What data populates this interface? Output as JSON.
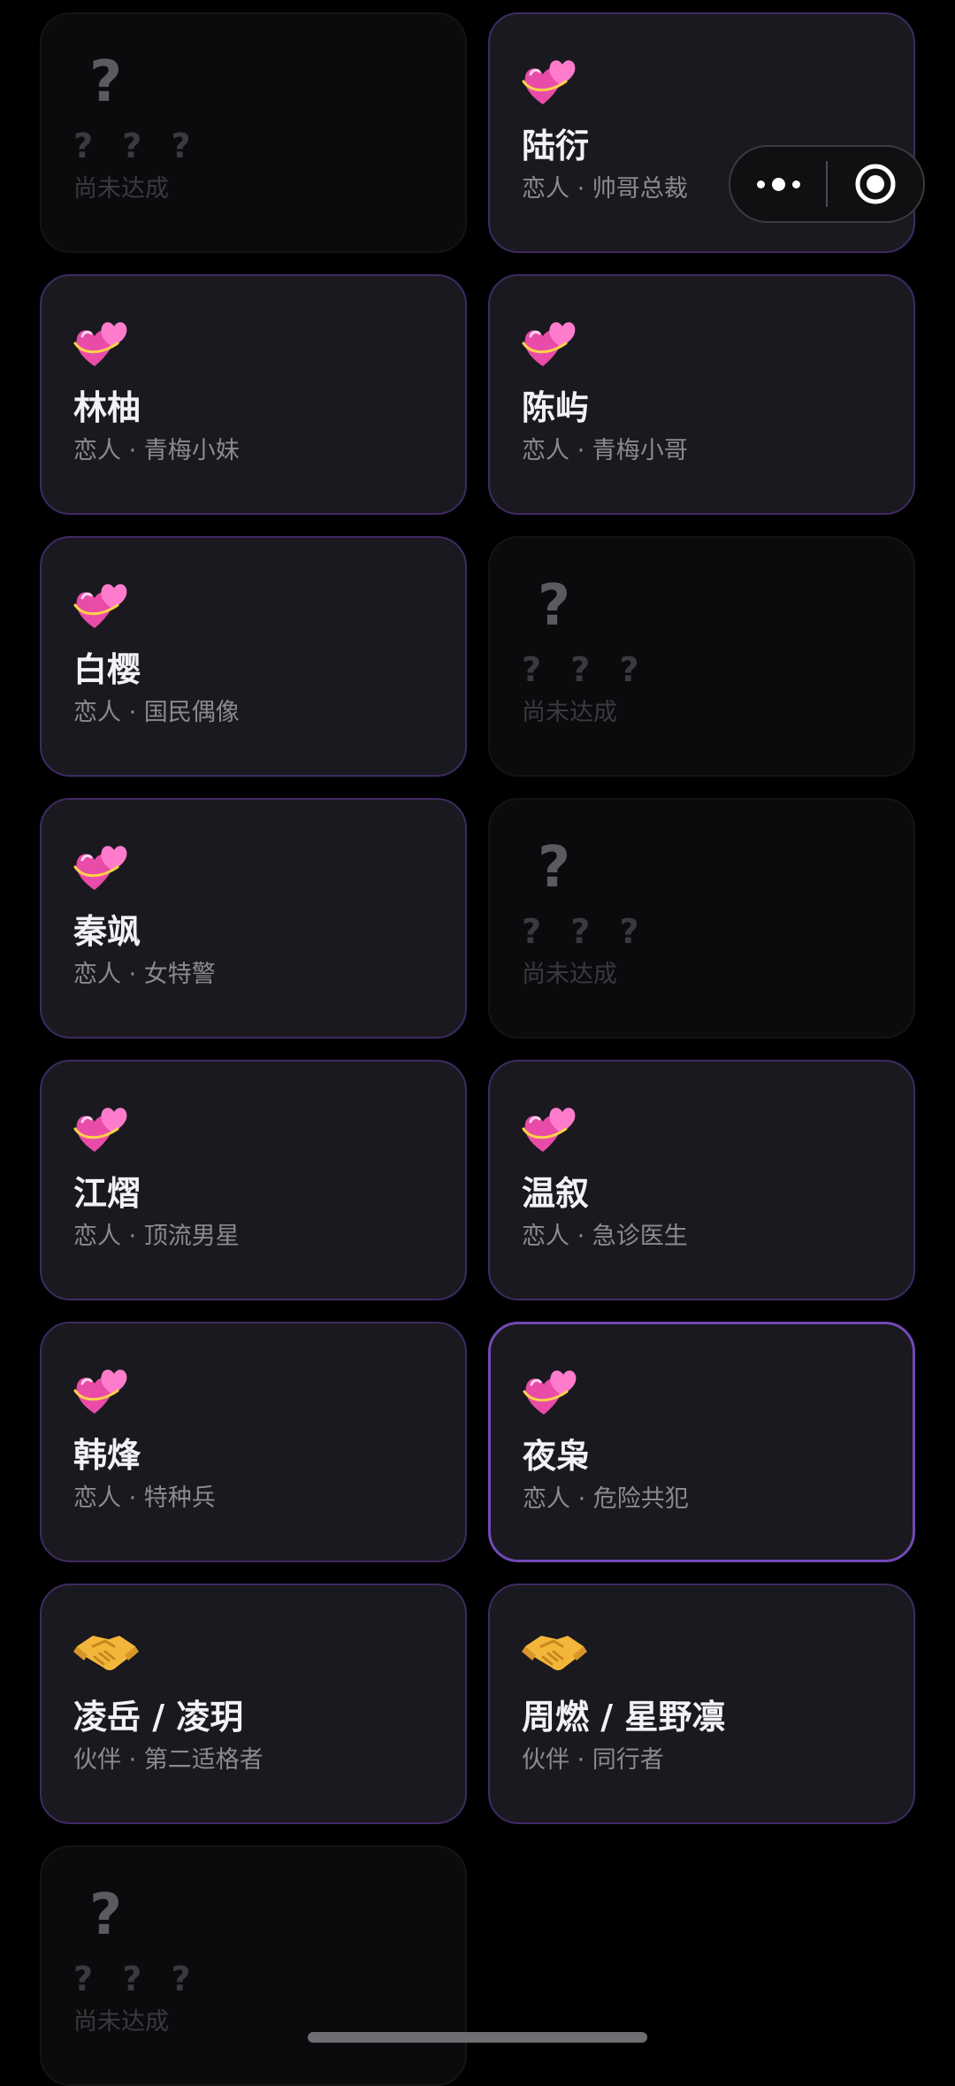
{
  "cards": [
    {
      "state": "locked",
      "icon": "question-mark",
      "icon_text": "?",
      "name": "? ? ?",
      "subtitle": "尚未达成"
    },
    {
      "state": "unlocked",
      "icon": "two-hearts-icon",
      "name": "陆衍",
      "subtitle": "恋人 · 帅哥总裁"
    },
    {
      "state": "unlocked",
      "icon": "two-hearts-icon",
      "name": "林柚",
      "subtitle": "恋人 · 青梅小妹"
    },
    {
      "state": "unlocked",
      "icon": "two-hearts-icon",
      "name": "陈屿",
      "subtitle": "恋人 · 青梅小哥"
    },
    {
      "state": "unlocked",
      "icon": "two-hearts-icon",
      "name": "白樱",
      "subtitle": "恋人 · 国民偶像"
    },
    {
      "state": "locked",
      "icon": "question-mark",
      "icon_text": "?",
      "name": "? ? ?",
      "subtitle": "尚未达成"
    },
    {
      "state": "unlocked",
      "icon": "two-hearts-icon",
      "name": "秦飒",
      "subtitle": "恋人 · 女特警"
    },
    {
      "state": "locked",
      "icon": "question-mark",
      "icon_text": "?",
      "name": "? ? ?",
      "subtitle": "尚未达成"
    },
    {
      "state": "unlocked",
      "icon": "two-hearts-icon",
      "name": "江熠",
      "subtitle": "恋人 · 顶流男星"
    },
    {
      "state": "unlocked",
      "icon": "two-hearts-icon",
      "name": "温叙",
      "subtitle": "恋人 · 急诊医生"
    },
    {
      "state": "unlocked",
      "icon": "two-hearts-icon",
      "name": "韩烽",
      "subtitle": "恋人 · 特种兵"
    },
    {
      "state": "unlocked",
      "icon": "two-hearts-icon",
      "name": "夜枭",
      "subtitle": "恋人 · 危险共犯",
      "highlight": true
    },
    {
      "state": "unlocked",
      "icon": "handshake-icon",
      "name": "凌岳 / 凌玥",
      "subtitle": "伙伴 · 第二适格者"
    },
    {
      "state": "unlocked",
      "icon": "handshake-icon",
      "name": "周燃 / 星野凛",
      "subtitle": "伙伴 · 同行者"
    },
    {
      "state": "locked",
      "icon": "question-mark",
      "icon_text": "?",
      "name": "? ? ?",
      "subtitle": "尚未达成"
    }
  ],
  "capsule": {
    "more_icon": "more-dots-icon",
    "close_icon": "target-close-icon"
  },
  "colors": {
    "background": "#000000",
    "card_unlocked_bg": "#1a191f",
    "card_unlocked_border": "#3e2a63",
    "card_highlight_border": "#7249b6",
    "card_locked_bg": "#0b0b0d",
    "heart_pink": "#f25db8",
    "handshake_yellow": "#f3b63a"
  }
}
